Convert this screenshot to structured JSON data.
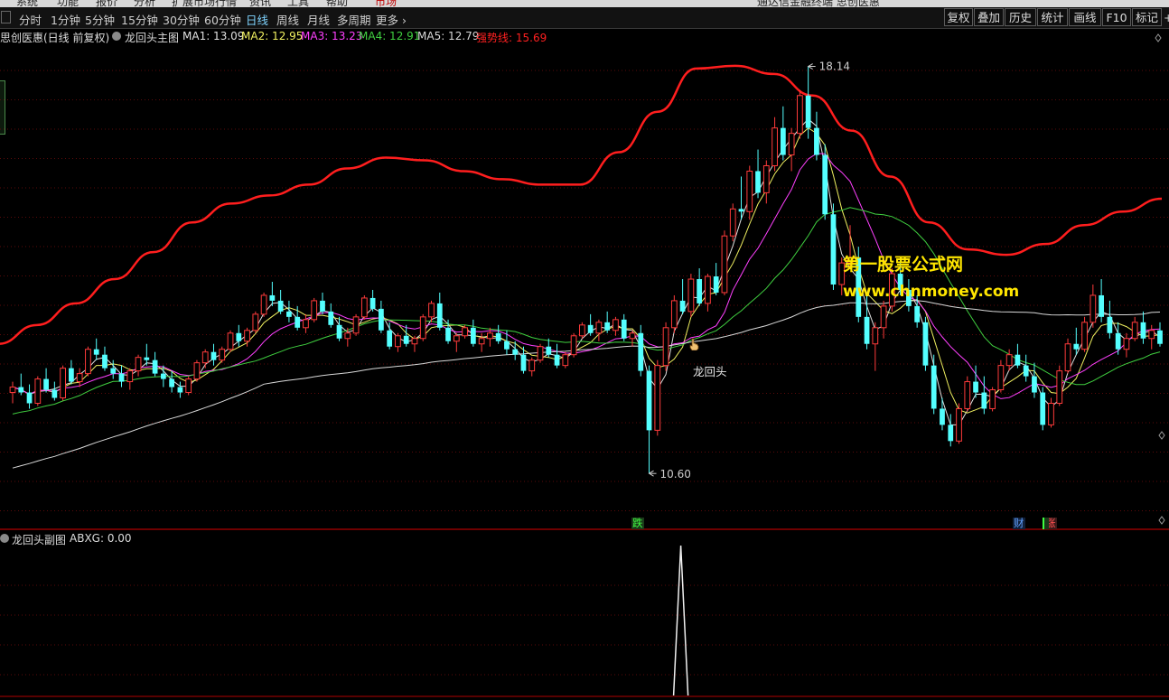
{
  "menubar": {
    "items": [
      "系统",
      "功能",
      "报价",
      "分析",
      "扩展市场行情",
      "资讯",
      "工具",
      "帮助",
      "市场"
    ],
    "title_center": "通达信金融终端 思创医惠"
  },
  "toolbar": {
    "periods": [
      "分时",
      "1分钟",
      "5分钟",
      "15分钟",
      "30分钟",
      "60分钟",
      "日线",
      "周线",
      "月线",
      "多周期",
      "更多"
    ],
    "active_period": "日线",
    "right_buttons": [
      "复权",
      "叠加",
      "历史",
      "统计",
      "画线",
      "F10",
      "标记"
    ]
  },
  "legend": {
    "stock_name": "思创医惠(日线 前复权)",
    "indicator_name": "龙回头主图",
    "items": [
      {
        "text": "MA1: 13.09",
        "color": "#e0e0e0"
      },
      {
        "text": "MA2: 12.95",
        "color": "#f0f060"
      },
      {
        "text": "MA3: 13.23",
        "color": "#ff40ff"
      },
      {
        "text": "MA4: 12.91",
        "color": "#40d040"
      },
      {
        "text": "MA5: 12.79",
        "color": "#d8d8d8"
      },
      {
        "text": "强势线: 15.69",
        "color": "#ff2020"
      }
    ]
  },
  "annotations": {
    "high_label": "18.14",
    "low_label": "10.60",
    "signal_label": "龙回头",
    "event_tags": [
      {
        "text": "跌",
        "color": "#40ff40",
        "bg": "#1a3a1a"
      },
      {
        "text": "财",
        "color": "#60a0ff",
        "bg": "#10203a"
      },
      {
        "text": "涨",
        "color": "#ff5050",
        "bg": "#3a1a1a"
      }
    ]
  },
  "watermark": {
    "line1": "第一股票公式网",
    "line2": "www.chnmoney.com"
  },
  "subchart": {
    "title": "龙回头副图",
    "value_text": "ABXG: 0.00"
  },
  "colors": {
    "up_candle": "#ff3b3b",
    "down_candle": "#54ffff",
    "strong_line": "#ff1e1e",
    "ma1": "#e0e0e0",
    "ma2": "#f0f060",
    "ma3": "#ff40ff",
    "ma4": "#40d040",
    "ma5": "#d8d8d8",
    "grid": "#5a0a0a"
  },
  "chart_data": [
    {
      "type": "candlestick",
      "title": "龙回头主图",
      "price_range": [
        9.8,
        18.5
      ],
      "high": 18.14,
      "low": 10.6,
      "candles": [
        [
          12.1,
          12.3,
          11.9,
          12.2
        ],
        [
          12.2,
          12.45,
          12.05,
          12.1
        ],
        [
          12.1,
          12.25,
          11.8,
          11.9
        ],
        [
          11.9,
          12.4,
          11.85,
          12.35
        ],
        [
          12.35,
          12.55,
          12.1,
          12.15
        ],
        [
          12.15,
          12.3,
          11.95,
          12.0
        ],
        [
          12.0,
          12.6,
          11.95,
          12.55
        ],
        [
          12.55,
          12.7,
          12.25,
          12.3
        ],
        [
          12.3,
          12.55,
          12.2,
          12.45
        ],
        [
          12.45,
          12.95,
          12.4,
          12.9
        ],
        [
          12.9,
          13.1,
          12.7,
          12.8
        ],
        [
          12.8,
          12.95,
          12.5,
          12.55
        ],
        [
          12.55,
          12.7,
          12.35,
          12.45
        ],
        [
          12.45,
          12.6,
          12.2,
          12.3
        ],
        [
          12.3,
          12.55,
          12.15,
          12.5
        ],
        [
          12.5,
          12.8,
          12.4,
          12.75
        ],
        [
          12.75,
          13.0,
          12.6,
          12.7
        ],
        [
          12.7,
          12.85,
          12.4,
          12.45
        ],
        [
          12.45,
          12.6,
          12.2,
          12.35
        ],
        [
          12.35,
          12.5,
          12.1,
          12.2
        ],
        [
          12.2,
          12.3,
          12.0,
          12.1
        ],
        [
          12.1,
          12.4,
          12.05,
          12.35
        ],
        [
          12.35,
          12.7,
          12.3,
          12.65
        ],
        [
          12.65,
          12.9,
          12.55,
          12.85
        ],
        [
          12.85,
          13.0,
          12.6,
          12.7
        ],
        [
          12.7,
          12.95,
          12.65,
          12.9
        ],
        [
          12.9,
          13.25,
          12.85,
          13.2
        ],
        [
          13.2,
          13.35,
          12.95,
          13.05
        ],
        [
          13.05,
          13.3,
          12.95,
          13.25
        ],
        [
          13.25,
          13.6,
          13.2,
          13.55
        ],
        [
          13.55,
          13.95,
          13.5,
          13.9
        ],
        [
          13.9,
          14.15,
          13.7,
          13.8
        ],
        [
          13.8,
          14.0,
          13.55,
          13.6
        ],
        [
          13.6,
          13.8,
          13.4,
          13.5
        ],
        [
          13.5,
          13.7,
          13.25,
          13.3
        ],
        [
          13.3,
          13.55,
          13.2,
          13.45
        ],
        [
          13.45,
          13.85,
          13.4,
          13.8
        ],
        [
          13.8,
          13.95,
          13.55,
          13.6
        ],
        [
          13.6,
          13.75,
          13.3,
          13.35
        ],
        [
          13.35,
          13.5,
          13.05,
          13.1
        ],
        [
          13.1,
          13.3,
          12.95,
          13.2
        ],
        [
          13.2,
          13.55,
          13.15,
          13.5
        ],
        [
          13.5,
          13.9,
          13.45,
          13.85
        ],
        [
          13.85,
          14.0,
          13.6,
          13.65
        ],
        [
          13.65,
          13.8,
          13.2,
          13.25
        ],
        [
          13.25,
          13.4,
          12.9,
          12.95
        ],
        [
          12.95,
          13.2,
          12.85,
          13.15
        ],
        [
          13.15,
          13.35,
          12.95,
          13.0
        ],
        [
          13.0,
          13.15,
          12.85,
          13.1
        ],
        [
          13.1,
          13.55,
          13.05,
          13.5
        ],
        [
          13.5,
          13.8,
          13.4,
          13.75
        ],
        [
          13.75,
          13.95,
          13.25,
          13.3
        ],
        [
          13.3,
          13.45,
          13.0,
          13.05
        ],
        [
          13.05,
          13.2,
          12.85,
          13.15
        ],
        [
          13.15,
          13.35,
          13.1,
          13.3
        ],
        [
          13.3,
          13.45,
          12.95,
          13.0
        ],
        [
          13.0,
          13.2,
          12.85,
          13.1
        ],
        [
          13.1,
          13.3,
          12.95,
          13.2
        ],
        [
          13.2,
          13.35,
          13.0,
          13.05
        ],
        [
          13.05,
          13.25,
          12.8,
          12.9
        ],
        [
          12.9,
          13.05,
          12.7,
          12.8
        ],
        [
          12.8,
          12.95,
          12.45,
          12.5
        ],
        [
          12.5,
          12.75,
          12.4,
          12.7
        ],
        [
          12.7,
          13.0,
          12.65,
          12.95
        ],
        [
          12.95,
          13.1,
          12.75,
          12.8
        ],
        [
          12.8,
          13.0,
          12.55,
          12.6
        ],
        [
          12.6,
          12.85,
          12.55,
          12.8
        ],
        [
          12.8,
          13.2,
          12.75,
          13.15
        ],
        [
          13.15,
          13.4,
          13.1,
          13.35
        ],
        [
          13.35,
          13.55,
          13.15,
          13.2
        ],
        [
          13.2,
          13.45,
          13.05,
          13.4
        ],
        [
          13.4,
          13.6,
          13.2,
          13.25
        ],
        [
          13.25,
          13.5,
          13.15,
          13.45
        ],
        [
          13.45,
          13.55,
          13.05,
          13.1
        ],
        [
          13.1,
          13.25,
          12.95,
          13.2
        ],
        [
          13.2,
          13.35,
          12.4,
          12.5
        ],
        [
          12.5,
          12.6,
          10.6,
          11.4
        ],
        [
          11.4,
          12.7,
          11.3,
          12.6
        ],
        [
          12.6,
          13.4,
          12.5,
          13.3
        ],
        [
          13.3,
          13.9,
          13.2,
          13.8
        ],
        [
          13.8,
          14.2,
          13.55,
          13.6
        ],
        [
          13.6,
          14.3,
          13.5,
          14.2
        ],
        [
          14.2,
          14.4,
          13.7,
          13.75
        ],
        [
          13.75,
          14.3,
          13.6,
          14.25
        ],
        [
          14.25,
          14.5,
          13.9,
          13.95
        ],
        [
          13.95,
          15.1,
          13.9,
          15.0
        ],
        [
          15.0,
          15.6,
          14.9,
          15.5
        ],
        [
          15.5,
          16.1,
          15.3,
          15.45
        ],
        [
          15.45,
          16.3,
          15.3,
          16.2
        ],
        [
          16.2,
          16.6,
          15.7,
          15.8
        ],
        [
          15.8,
          16.4,
          15.6,
          16.3
        ],
        [
          16.3,
          17.2,
          16.2,
          17.0
        ],
        [
          17.0,
          17.4,
          16.4,
          16.5
        ],
        [
          16.5,
          17.0,
          16.2,
          16.9
        ],
        [
          16.9,
          17.7,
          16.8,
          17.6
        ],
        [
          17.6,
          18.14,
          16.8,
          17.0
        ],
        [
          17.0,
          17.3,
          16.4,
          16.5
        ],
        [
          16.5,
          16.7,
          15.3,
          15.4
        ],
        [
          15.4,
          15.6,
          14.0,
          14.1
        ],
        [
          14.1,
          14.6,
          13.9,
          14.5
        ],
        [
          14.5,
          15.2,
          14.4,
          14.6
        ],
        [
          14.6,
          14.8,
          13.4,
          13.5
        ],
        [
          13.5,
          13.9,
          12.9,
          13.0
        ],
        [
          13.0,
          13.4,
          12.5,
          13.3
        ],
        [
          13.3,
          13.8,
          13.1,
          13.7
        ],
        [
          13.7,
          14.4,
          13.6,
          14.3
        ],
        [
          14.3,
          14.6,
          13.9,
          14.0
        ],
        [
          14.0,
          14.2,
          13.6,
          13.7
        ],
        [
          13.7,
          13.9,
          13.3,
          13.4
        ],
        [
          13.4,
          13.5,
          12.5,
          12.6
        ],
        [
          12.6,
          12.8,
          11.7,
          11.8
        ],
        [
          11.8,
          12.0,
          11.4,
          11.5
        ],
        [
          11.5,
          11.7,
          11.1,
          11.2
        ],
        [
          11.2,
          11.9,
          11.15,
          11.8
        ],
        [
          11.8,
          12.4,
          11.75,
          12.3
        ],
        [
          12.3,
          12.6,
          12.0,
          12.1
        ],
        [
          12.1,
          12.4,
          11.7,
          11.8
        ],
        [
          11.8,
          12.2,
          11.75,
          12.15
        ],
        [
          12.15,
          12.7,
          12.1,
          12.6
        ],
        [
          12.6,
          12.9,
          12.5,
          12.8
        ],
        [
          12.8,
          13.0,
          12.55,
          12.6
        ],
        [
          12.6,
          12.8,
          12.3,
          12.4
        ],
        [
          12.4,
          12.65,
          12.0,
          12.1
        ],
        [
          12.1,
          12.2,
          11.4,
          11.5
        ],
        [
          11.5,
          12.0,
          11.45,
          11.9
        ],
        [
          11.9,
          12.6,
          11.85,
          12.5
        ],
        [
          12.5,
          13.1,
          12.45,
          13.0
        ],
        [
          13.0,
          13.3,
          12.8,
          12.9
        ],
        [
          12.9,
          13.5,
          12.85,
          13.4
        ],
        [
          13.4,
          14.1,
          13.3,
          13.9
        ],
        [
          13.9,
          14.2,
          13.4,
          13.5
        ],
        [
          13.5,
          13.8,
          13.1,
          13.2
        ],
        [
          13.2,
          13.4,
          12.8,
          12.9
        ],
        [
          12.9,
          13.2,
          12.75,
          13.1
        ],
        [
          13.1,
          13.5,
          13.05,
          13.4
        ],
        [
          13.4,
          13.6,
          13.0,
          13.1
        ],
        [
          13.1,
          13.35,
          12.9,
          13.25
        ],
        [
          13.25,
          13.4,
          12.95,
          13.0
        ]
      ],
      "ma_series": [
        "MA1",
        "MA2",
        "MA3",
        "MA4",
        "MA5"
      ],
      "strong_line": [
        13.0,
        13.35,
        13.75,
        14.2,
        14.7,
        15.25,
        15.6,
        15.75,
        15.95,
        16.25,
        16.45,
        16.4,
        16.2,
        16.05,
        15.95,
        15.95,
        16.55,
        17.3,
        18.1,
        18.15,
        18.0,
        17.6,
        16.95,
        16.1,
        15.25,
        14.75,
        14.65,
        14.85,
        15.2,
        15.45,
        15.69
      ]
    },
    {
      "type": "line",
      "title": "龙回头副图",
      "series": [
        {
          "name": "ABXG",
          "signal_index": 80,
          "signal_value": 1,
          "current_value": 0
        }
      ],
      "ylim": [
        0,
        1
      ]
    }
  ]
}
